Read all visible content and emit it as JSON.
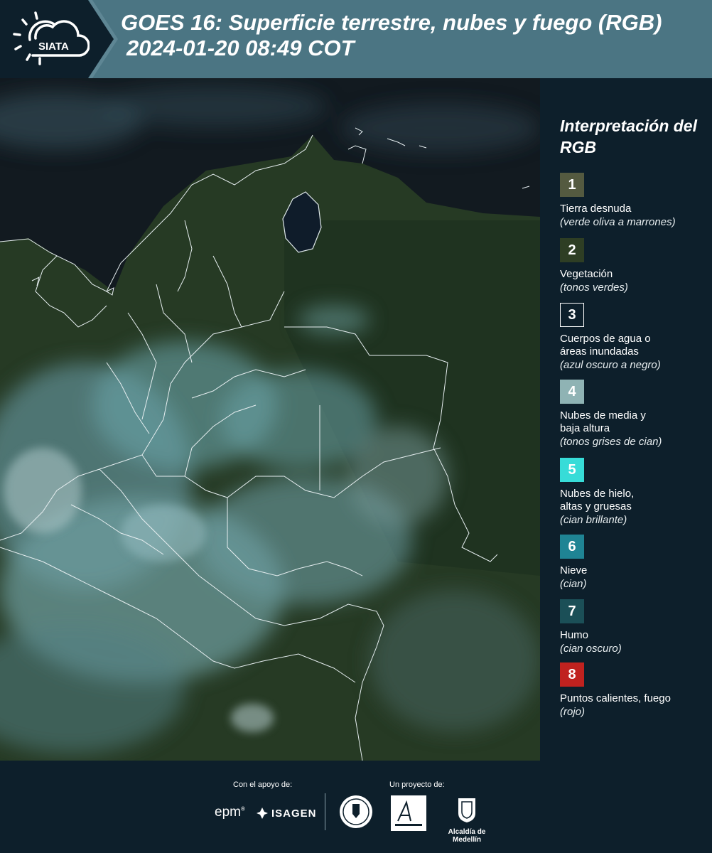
{
  "header": {
    "brand": "SIATA",
    "title_line1": "GOES 16: Superficie terrestre, nubes y fuego (RGB)",
    "title_line2": "2024-01-20 08:49 COT"
  },
  "legend": {
    "title": "Interpretación del RGB",
    "items": [
      {
        "number": "1",
        "label": "Tierra desnuda",
        "note": "(verde oliva a marrones)",
        "color": "#545a40"
      },
      {
        "number": "2",
        "label": "Vegetación",
        "note": "(tonos verdes)",
        "color": "#2e3e24"
      },
      {
        "number": "3",
        "label": "Cuerpos de agua o\náreas inundadas",
        "note": "(azul oscuro a negro)",
        "color": "#0d1f2b"
      },
      {
        "number": "4",
        "label": "Nubes de media y\nbaja altura",
        "note": "(tonos grises de cian)",
        "color": "#8fb3b4"
      },
      {
        "number": "5",
        "label": "Nubes de hielo,\naltas y gruesas",
        "note": "(cian brillante)",
        "color": "#37dcd8"
      },
      {
        "number": "6",
        "label": "Nieve",
        "note": "(cian)",
        "color": "#1f8494"
      },
      {
        "number": "7",
        "label": "Humo",
        "note": "(cian oscuro)",
        "color": "#1b4f57"
      },
      {
        "number": "8",
        "label": "Puntos calientes, fuego",
        "note": "(rojo)",
        "color": "#c0221f"
      }
    ]
  },
  "footer": {
    "support_label": "Con el apoyo de:",
    "project_label": "Un proyecto de:",
    "sponsor1": "epm",
    "sponsor2": "ISAGEN",
    "partner_alcaldia": "Alcaldía de Medellín"
  }
}
